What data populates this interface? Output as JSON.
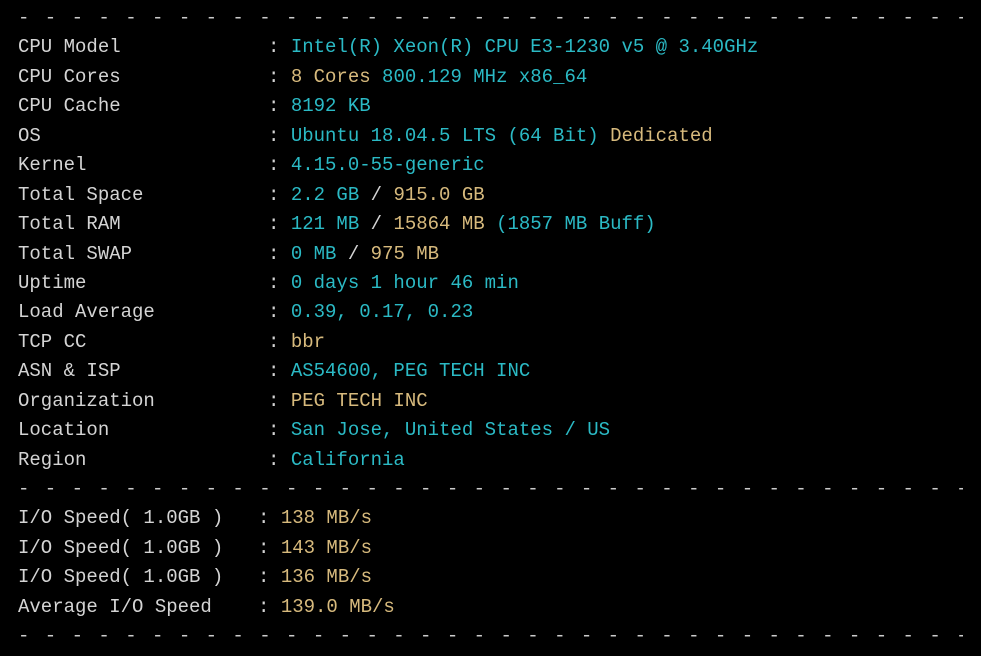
{
  "divider": "- - - - - - - - - - - - - - - - - - - - - - - - - - - - - - - - - - - - - - - - - - - - - - - - - - - - - - - - - - - - - - - - - -",
  "sys": {
    "cpu_model_label": "CPU Model",
    "cpu_model_value": "Intel(R) Xeon(R) CPU E3-1230 v5 @ 3.40GHz",
    "cpu_cores_label": "CPU Cores",
    "cpu_cores_count": "8 Cores",
    "cpu_cores_freq": "800.129 MHz x86_64",
    "cpu_cache_label": "CPU Cache",
    "cpu_cache_value": "8192 KB",
    "os_label": "OS",
    "os_value": "Ubuntu 18.04.5 LTS (64 Bit)",
    "os_type": "Dedicated",
    "kernel_label": "Kernel",
    "kernel_value": "4.15.0-55-generic",
    "total_space_label": "Total Space",
    "total_space_used": "2.2 GB",
    "total_space_sep": " / ",
    "total_space_total": "915.0 GB",
    "total_ram_label": "Total RAM",
    "total_ram_used": "121 MB",
    "total_ram_sep": " / ",
    "total_ram_total": "15864 MB",
    "total_ram_buff": "(1857 MB Buff)",
    "total_swap_label": "Total SWAP",
    "total_swap_used": "0 MB",
    "total_swap_sep": " / ",
    "total_swap_total": "975 MB",
    "uptime_label": "Uptime",
    "uptime_value": "0 days 1 hour 46 min",
    "load_label": "Load Average",
    "load_value": "0.39, 0.17, 0.23",
    "tcp_cc_label": "TCP CC",
    "tcp_cc_value": "bbr",
    "asn_label": "ASN & ISP",
    "asn_value": "AS54600, PEG TECH INC",
    "org_label": "Organization",
    "org_value": "PEG TECH INC",
    "location_label": "Location",
    "location_value": "San Jose, United States / US",
    "region_label": "Region",
    "region_value": "California"
  },
  "io": {
    "speed1_label": "I/O Speed( 1.0GB )",
    "speed1_value": "138 MB/s",
    "speed2_label": "I/O Speed( 1.0GB )",
    "speed2_value": "143 MB/s",
    "speed3_label": "I/O Speed( 1.0GB )",
    "speed3_value": "136 MB/s",
    "avg_label": "Average I/O Speed",
    "avg_value": "139.0 MB/s"
  }
}
